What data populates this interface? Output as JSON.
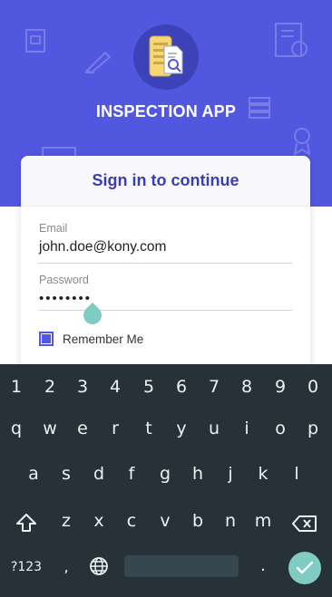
{
  "app": {
    "title": "INSPECTION APP",
    "accent": "#5257e0"
  },
  "signin": {
    "heading": "Sign in to continue",
    "email_label": "Email",
    "email_value": "john.doe@kony.com",
    "password_label": "Password",
    "password_value": "••••••••",
    "remember_label": "Remember Me",
    "remember_checked": true
  },
  "keyboard": {
    "number_row": [
      "1",
      "2",
      "3",
      "4",
      "5",
      "6",
      "7",
      "8",
      "9",
      "0"
    ],
    "row1": [
      "q",
      "w",
      "e",
      "r",
      "t",
      "y",
      "u",
      "i",
      "o",
      "p"
    ],
    "row2": [
      "a",
      "s",
      "d",
      "f",
      "g",
      "h",
      "j",
      "k",
      "l"
    ],
    "row3": [
      "z",
      "x",
      "c",
      "v",
      "b",
      "n",
      "m"
    ],
    "symbols_label": "?123",
    "comma": ",",
    "period": ".",
    "icons": [
      "shift-icon",
      "backspace-icon",
      "globe-icon",
      "check-icon"
    ]
  }
}
